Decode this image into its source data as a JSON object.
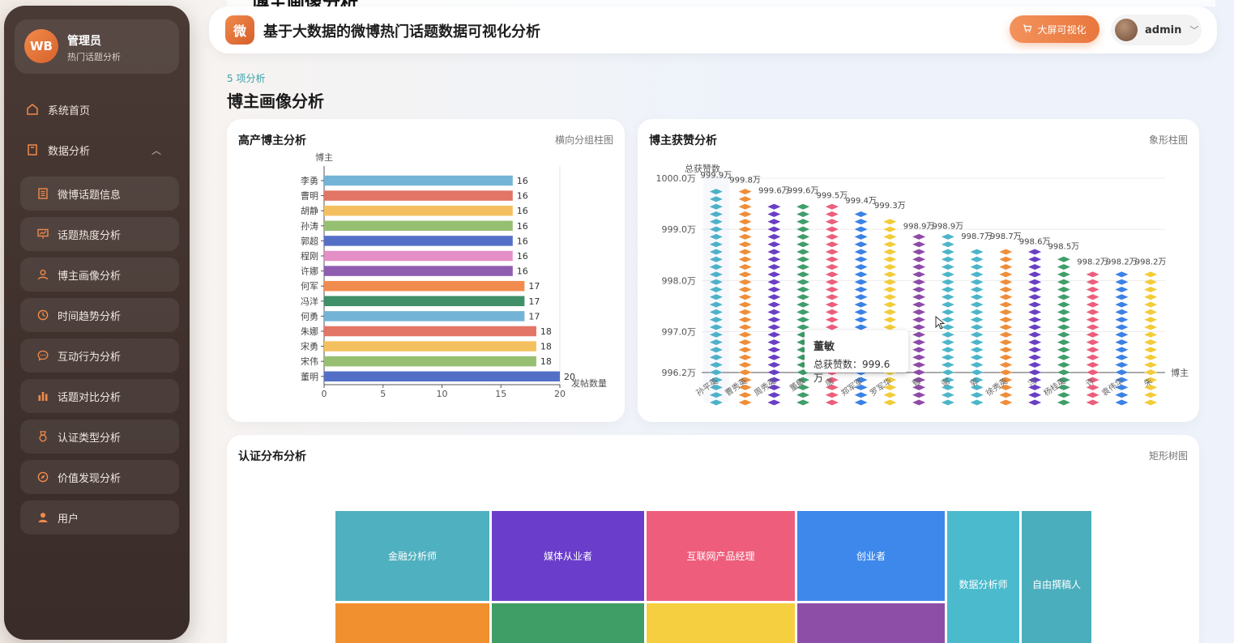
{
  "sidebar": {
    "logo": "WB",
    "name": "管理员",
    "subtitle": "热门话题分析",
    "home": "系统首页",
    "data_analysis": "数据分析",
    "items": [
      {
        "label": "微博话题信息"
      },
      {
        "label": "话题热度分析"
      },
      {
        "label": "博主画像分析"
      },
      {
        "label": "时间趋势分析"
      },
      {
        "label": "互动行为分析"
      },
      {
        "label": "话题对比分析"
      },
      {
        "label": "认证类型分析"
      },
      {
        "label": "价值发现分析"
      },
      {
        "label": "用户"
      }
    ]
  },
  "header": {
    "logo": "微",
    "title": "基于大数据的微博热门话题数据可视化分析",
    "big_screen": "大屏可视化",
    "user": "admin",
    "ghost_title": "博主画像分析"
  },
  "page": {
    "crumb": "5 项分析",
    "title": "博主画像分析"
  },
  "cards": {
    "c1": {
      "title": "高产博主分析",
      "tag": "横向分组柱图"
    },
    "c2": {
      "title": "博主获赞分析",
      "tag": "象形柱图"
    },
    "c3": {
      "title": "认证分布分析",
      "tag": "矩形树图"
    }
  },
  "tooltip": {
    "name": "董敏",
    "value": "总获赞数：999.6万"
  },
  "chart_data": [
    {
      "type": "bar",
      "orientation": "horizontal",
      "ylabel": "博主",
      "xlabel": "发帖数量",
      "xlim": [
        0,
        20
      ],
      "xticks": [
        0,
        5,
        10,
        15,
        20
      ],
      "categories": [
        "李勇",
        "曹明",
        "胡静",
        "孙涛",
        "郭超",
        "程刚",
        "许娜",
        "何军",
        "冯洋",
        "何勇",
        "朱娜",
        "宋勇",
        "宋伟",
        "董明"
      ],
      "values": [
        16,
        16,
        16,
        16,
        16,
        16,
        16,
        17,
        17,
        17,
        18,
        18,
        18,
        20
      ],
      "colors": [
        "#73b4d6",
        "#e27566",
        "#f4c05f",
        "#97bf72",
        "#5470c6",
        "#e490c7",
        "#8e5db0",
        "#f28b4e",
        "#3f8f68",
        "#73b4d6",
        "#e27566",
        "#f4c05f",
        "#97bf72",
        "#5470c6"
      ]
    },
    {
      "type": "bar",
      "pictorial": true,
      "ylabel": "总获赞数",
      "xlabel": "博主",
      "ylim": [
        996.2,
        1000.0
      ],
      "yticks": [
        "996.2万",
        "997.0万",
        "998.0万",
        "999.0万",
        "1000.0万"
      ],
      "ytick_values": [
        996.2,
        997.0,
        998.0,
        999.0,
        1000.0
      ],
      "categories": [
        "孙平英",
        "曹秀英",
        "周秀英",
        "董敏",
        "唐",
        "郑军军",
        "罗军华",
        "曹",
        "谢",
        "郭",
        "徐秀英",
        "冯",
        "杨桂英",
        "许",
        "袁伟华",
        "朱"
      ],
      "values": [
        999.9,
        999.8,
        999.6,
        999.6,
        999.5,
        999.4,
        999.3,
        998.9,
        998.9,
        998.7,
        998.7,
        998.6,
        998.5,
        998.2,
        998.2,
        998.2
      ],
      "labels": [
        "999.9万",
        "999.8万",
        "999.6万",
        "999.6万",
        "999.5万",
        "999.4万",
        "999.3万",
        "998.9万",
        "998.9万",
        "998.7万",
        "998.7万",
        "998.6万",
        "998.5万",
        "998.2万",
        "998.2万",
        "998.2万"
      ],
      "colors": [
        "#4db2c8",
        "#ef8e3a",
        "#6a3fc4",
        "#3f9e6a",
        "#ec5e7c",
        "#3b82e6",
        "#f2cc3a",
        "#8e4aa8",
        "#4cb6c9",
        "#4cb6c9",
        "#ef8e3a",
        "#6a3fc4",
        "#3f9e6a",
        "#ec5e7c",
        "#3b82e6",
        "#f2cc3a"
      ]
    },
    {
      "type": "treemap",
      "items": [
        {
          "name": "金融分析师",
          "color": "#4fb0bf"
        },
        {
          "name": "媒体从业者",
          "color": "#6a3ecb"
        },
        {
          "name": "互联网产品经理",
          "color": "#ee5e7c"
        },
        {
          "name": "创业者",
          "color": "#3e88ec"
        },
        {
          "name": "数据分析师",
          "color": "#4bbacd"
        },
        {
          "name": "自由撰稿人",
          "color": "#4baebd"
        },
        {
          "name": "",
          "color": "#f1902f"
        },
        {
          "name": "",
          "color": "#3f9d66"
        },
        {
          "name": "",
          "color": "#f5cf3f"
        },
        {
          "name": "",
          "color": "#8d4ea8"
        }
      ]
    }
  ]
}
